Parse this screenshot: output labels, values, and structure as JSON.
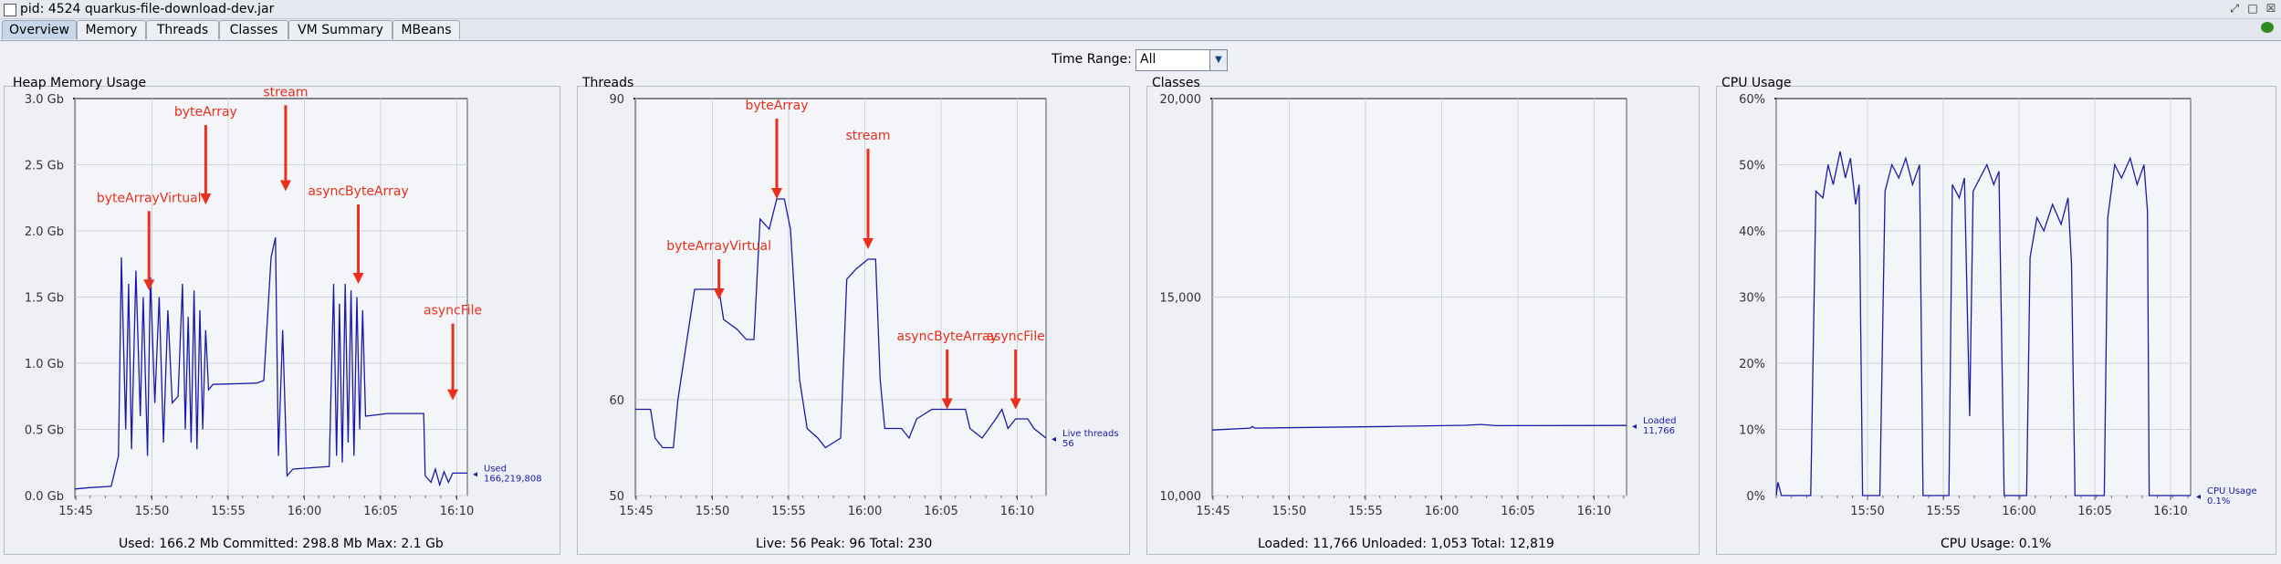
{
  "window": {
    "title": "pid: 4524 quarkus-file-download-dev.jar",
    "controls": [
      "detach-icon",
      "maximize-icon",
      "close-icon"
    ]
  },
  "tabs": [
    {
      "label": "Overview",
      "active": true
    },
    {
      "label": "Memory"
    },
    {
      "label": "Threads"
    },
    {
      "label": "Classes"
    },
    {
      "label": "VM Summary"
    },
    {
      "label": "MBeans"
    }
  ],
  "time_range": {
    "label": "Time Range:",
    "value": "All"
  },
  "colors": {
    "line": "#1a1aa8",
    "annotation": "#e8301c",
    "grid": "#cfd3da",
    "plot_bg": "#f4f5f8"
  },
  "panels": {
    "heap": {
      "title": "Heap Memory Usage",
      "footer": "Used: 166.2 Mb    Committed: 298.8 Mb    Max: 2.1 Gb",
      "legend": [
        "Used",
        "166,219,808"
      ]
    },
    "threads": {
      "title": "Threads",
      "footer": "Live: 56    Peak: 96    Total: 230",
      "legend": [
        "Live threads",
        "56"
      ]
    },
    "classes": {
      "title": "Classes",
      "footer": "Loaded: 11,766    Unloaded: 1,053    Total: 12,819",
      "legend": [
        "Loaded",
        "11,766"
      ]
    },
    "cpu": {
      "title": "CPU Usage",
      "footer": "CPU Usage: 0.1%",
      "legend": [
        "CPU Usage",
        "0.1%"
      ]
    }
  },
  "chart_data": [
    {
      "name": "heap",
      "type": "line",
      "xticks": [
        "15:45",
        "15:50",
        "15:55",
        "16:00",
        "16:05",
        "16:10"
      ],
      "yticks": [
        "0.0 Gb",
        "0.5 Gb",
        "1.0 Gb",
        "1.5 Gb",
        "2.0 Gb",
        "2.5 Gb",
        "3.0 Gb"
      ],
      "xlim": [
        43.5,
        70.5
      ],
      "ylim": [
        0,
        3.0
      ],
      "points": [
        [
          43.5,
          0.05
        ],
        [
          44.5,
          0.06
        ],
        [
          46,
          0.07
        ],
        [
          46.5,
          0.3
        ],
        [
          46.7,
          1.8
        ],
        [
          47.0,
          0.5
        ],
        [
          47.2,
          1.6
        ],
        [
          47.4,
          0.35
        ],
        [
          47.7,
          1.7
        ],
        [
          48.0,
          0.6
        ],
        [
          48.2,
          1.5
        ],
        [
          48.5,
          0.3
        ],
        [
          48.7,
          1.65
        ],
        [
          49.0,
          0.7
        ],
        [
          49.3,
          1.5
        ],
        [
          49.6,
          0.4
        ],
        [
          49.9,
          1.4
        ],
        [
          50.2,
          0.7
        ],
        [
          50.6,
          0.75
        ],
        [
          50.9,
          1.6
        ],
        [
          51.1,
          0.5
        ],
        [
          51.3,
          1.35
        ],
        [
          51.5,
          0.4
        ],
        [
          51.7,
          1.55
        ],
        [
          51.9,
          0.35
        ],
        [
          52.1,
          1.4
        ],
        [
          52.3,
          0.5
        ],
        [
          52.5,
          1.25
        ],
        [
          52.7,
          0.8
        ],
        [
          53,
          0.84
        ],
        [
          56,
          0.85
        ],
        [
          56.5,
          0.87
        ],
        [
          57,
          1.8
        ],
        [
          57.3,
          1.95
        ],
        [
          57.5,
          0.3
        ],
        [
          57.8,
          1.25
        ],
        [
          58.1,
          0.15
        ],
        [
          58.5,
          0.2
        ],
        [
          61,
          0.22
        ],
        [
          61.3,
          1.6
        ],
        [
          61.5,
          0.3
        ],
        [
          61.7,
          1.45
        ],
        [
          61.9,
          0.25
        ],
        [
          62.1,
          1.6
        ],
        [
          62.3,
          0.4
        ],
        [
          62.5,
          1.55
        ],
        [
          62.7,
          0.3
        ],
        [
          62.9,
          1.5
        ],
        [
          63.1,
          0.5
        ],
        [
          63.3,
          1.4
        ],
        [
          63.5,
          0.6
        ],
        [
          65,
          0.62
        ],
        [
          67.5,
          0.62
        ],
        [
          67.6,
          0.15
        ],
        [
          68,
          0.1
        ],
        [
          68.3,
          0.2
        ],
        [
          68.6,
          0.08
        ],
        [
          68.9,
          0.18
        ],
        [
          69.2,
          0.1
        ],
        [
          69.5,
          0.17
        ],
        [
          70.5,
          0.17
        ]
      ],
      "annotations": [
        {
          "text": "byteArrayVirtual",
          "x": 48.6,
          "y_from": 2.15,
          "y_to": 1.55
        },
        {
          "text": "byteArray",
          "x": 52.5,
          "y_from": 2.8,
          "y_to": 2.2
        },
        {
          "text": "stream",
          "x": 58.0,
          "y_from": 2.95,
          "y_to": 2.3
        },
        {
          "text": "asyncByteArray",
          "x": 63.0,
          "y_from": 2.2,
          "y_to": 1.6
        },
        {
          "text": "asyncFile",
          "x": 69.5,
          "y_from": 1.3,
          "y_to": 0.72
        }
      ]
    },
    {
      "name": "threads",
      "type": "line",
      "xticks": [
        "15:45",
        "15:50",
        "15:55",
        "16:00",
        "16:05",
        "16:10"
      ],
      "yticks": [
        "50",
        "60",
        "90"
      ],
      "ylim_display": "broken axis 50–60 then 60–90",
      "xlim": [
        43.5,
        70.5
      ],
      "points": [
        [
          43.5,
          59
        ],
        [
          44.5,
          59
        ],
        [
          44.8,
          56
        ],
        [
          45.3,
          55
        ],
        [
          46,
          55
        ],
        [
          46.3,
          60
        ],
        [
          47,
          67
        ],
        [
          47.4,
          71
        ],
        [
          49,
          71
        ],
        [
          49.3,
          68
        ],
        [
          50.2,
          67
        ],
        [
          50.8,
          66
        ],
        [
          51.3,
          66
        ],
        [
          51.7,
          78
        ],
        [
          52.3,
          77
        ],
        [
          52.8,
          80
        ],
        [
          53.3,
          80
        ],
        [
          53.7,
          77
        ],
        [
          54.3,
          62
        ],
        [
          54.8,
          57
        ],
        [
          55.5,
          56
        ],
        [
          56,
          55
        ],
        [
          57,
          56
        ],
        [
          57.4,
          72
        ],
        [
          58,
          73
        ],
        [
          58.8,
          74
        ],
        [
          59.3,
          74
        ],
        [
          59.6,
          62
        ],
        [
          59.9,
          57
        ],
        [
          61,
          57
        ],
        [
          61.5,
          56
        ],
        [
          62,
          58
        ],
        [
          63,
          59
        ],
        [
          65.2,
          59
        ],
        [
          65.5,
          57
        ],
        [
          66.3,
          56
        ],
        [
          67.2,
          58
        ],
        [
          67.6,
          59
        ],
        [
          68.0,
          57
        ],
        [
          68.5,
          58
        ],
        [
          69.3,
          58
        ],
        [
          69.7,
          57
        ],
        [
          70.5,
          56
        ]
      ],
      "annotations": [
        {
          "text": "byteArrayVirtual",
          "x": 49.0,
          "y_from": 74,
          "y_to": 70
        },
        {
          "text": "byteArray",
          "x": 52.8,
          "y_from": 88,
          "y_to": 80
        },
        {
          "text": "stream",
          "x": 58.8,
          "y_from": 85,
          "y_to": 75
        },
        {
          "text": "asyncByteArray",
          "x": 64.0,
          "y_from": 65,
          "y_to": 59
        },
        {
          "text": "asyncFile",
          "x": 68.5,
          "y_from": 65,
          "y_to": 59
        }
      ]
    },
    {
      "name": "classes",
      "type": "line",
      "xticks": [
        "15:45",
        "15:50",
        "15:55",
        "16:00",
        "16:05",
        "16:10"
      ],
      "yticks": [
        "10,000",
        "15,000",
        "20,000"
      ],
      "xlim": [
        43.5,
        70.5
      ],
      "ylim": [
        10000,
        20000
      ],
      "points": [
        [
          43.5,
          11650
        ],
        [
          46,
          11700
        ],
        [
          46.1,
          11740
        ],
        [
          46.3,
          11700
        ],
        [
          55,
          11740
        ],
        [
          60,
          11770
        ],
        [
          61,
          11790
        ],
        [
          62,
          11760
        ],
        [
          70.5,
          11766
        ]
      ]
    },
    {
      "name": "cpu",
      "type": "line",
      "xticks": [
        "15:50",
        "15:55",
        "16:00",
        "16:05",
        "16:10"
      ],
      "yticks": [
        "0%",
        "10%",
        "20%",
        "30%",
        "40%",
        "50%",
        "60%"
      ],
      "xlim": [
        46.5,
        70.5
      ],
      "ylim": [
        0,
        60
      ],
      "points": [
        [
          46.5,
          0
        ],
        [
          46.6,
          2
        ],
        [
          46.8,
          0
        ],
        [
          48.5,
          0
        ],
        [
          48.8,
          46
        ],
        [
          49.2,
          45
        ],
        [
          49.5,
          50
        ],
        [
          49.8,
          47
        ],
        [
          50.2,
          52
        ],
        [
          50.5,
          48
        ],
        [
          50.8,
          51
        ],
        [
          51.1,
          44
        ],
        [
          51.3,
          47
        ],
        [
          51.5,
          0
        ],
        [
          52.5,
          0
        ],
        [
          52.8,
          46
        ],
        [
          53.2,
          50
        ],
        [
          53.6,
          48
        ],
        [
          54,
          51
        ],
        [
          54.4,
          47
        ],
        [
          54.8,
          50
        ],
        [
          55.0,
          0
        ],
        [
          56.5,
          0
        ],
        [
          56.7,
          47
        ],
        [
          57.1,
          45
        ],
        [
          57.4,
          48
        ],
        [
          57.7,
          12
        ],
        [
          57.9,
          46
        ],
        [
          58.3,
          48
        ],
        [
          58.7,
          50
        ],
        [
          59.1,
          47
        ],
        [
          59.4,
          49
        ],
        [
          59.7,
          0
        ],
        [
          61,
          0
        ],
        [
          61.2,
          36
        ],
        [
          61.6,
          42
        ],
        [
          62,
          40
        ],
        [
          62.5,
          44
        ],
        [
          63,
          41
        ],
        [
          63.4,
          45
        ],
        [
          63.6,
          35
        ],
        [
          63.8,
          0
        ],
        [
          65.5,
          0
        ],
        [
          65.7,
          42
        ],
        [
          66.1,
          50
        ],
        [
          66.5,
          48
        ],
        [
          67,
          51
        ],
        [
          67.4,
          47
        ],
        [
          67.8,
          50
        ],
        [
          68.0,
          43
        ],
        [
          68.1,
          0
        ],
        [
          70.5,
          0
        ]
      ]
    }
  ]
}
